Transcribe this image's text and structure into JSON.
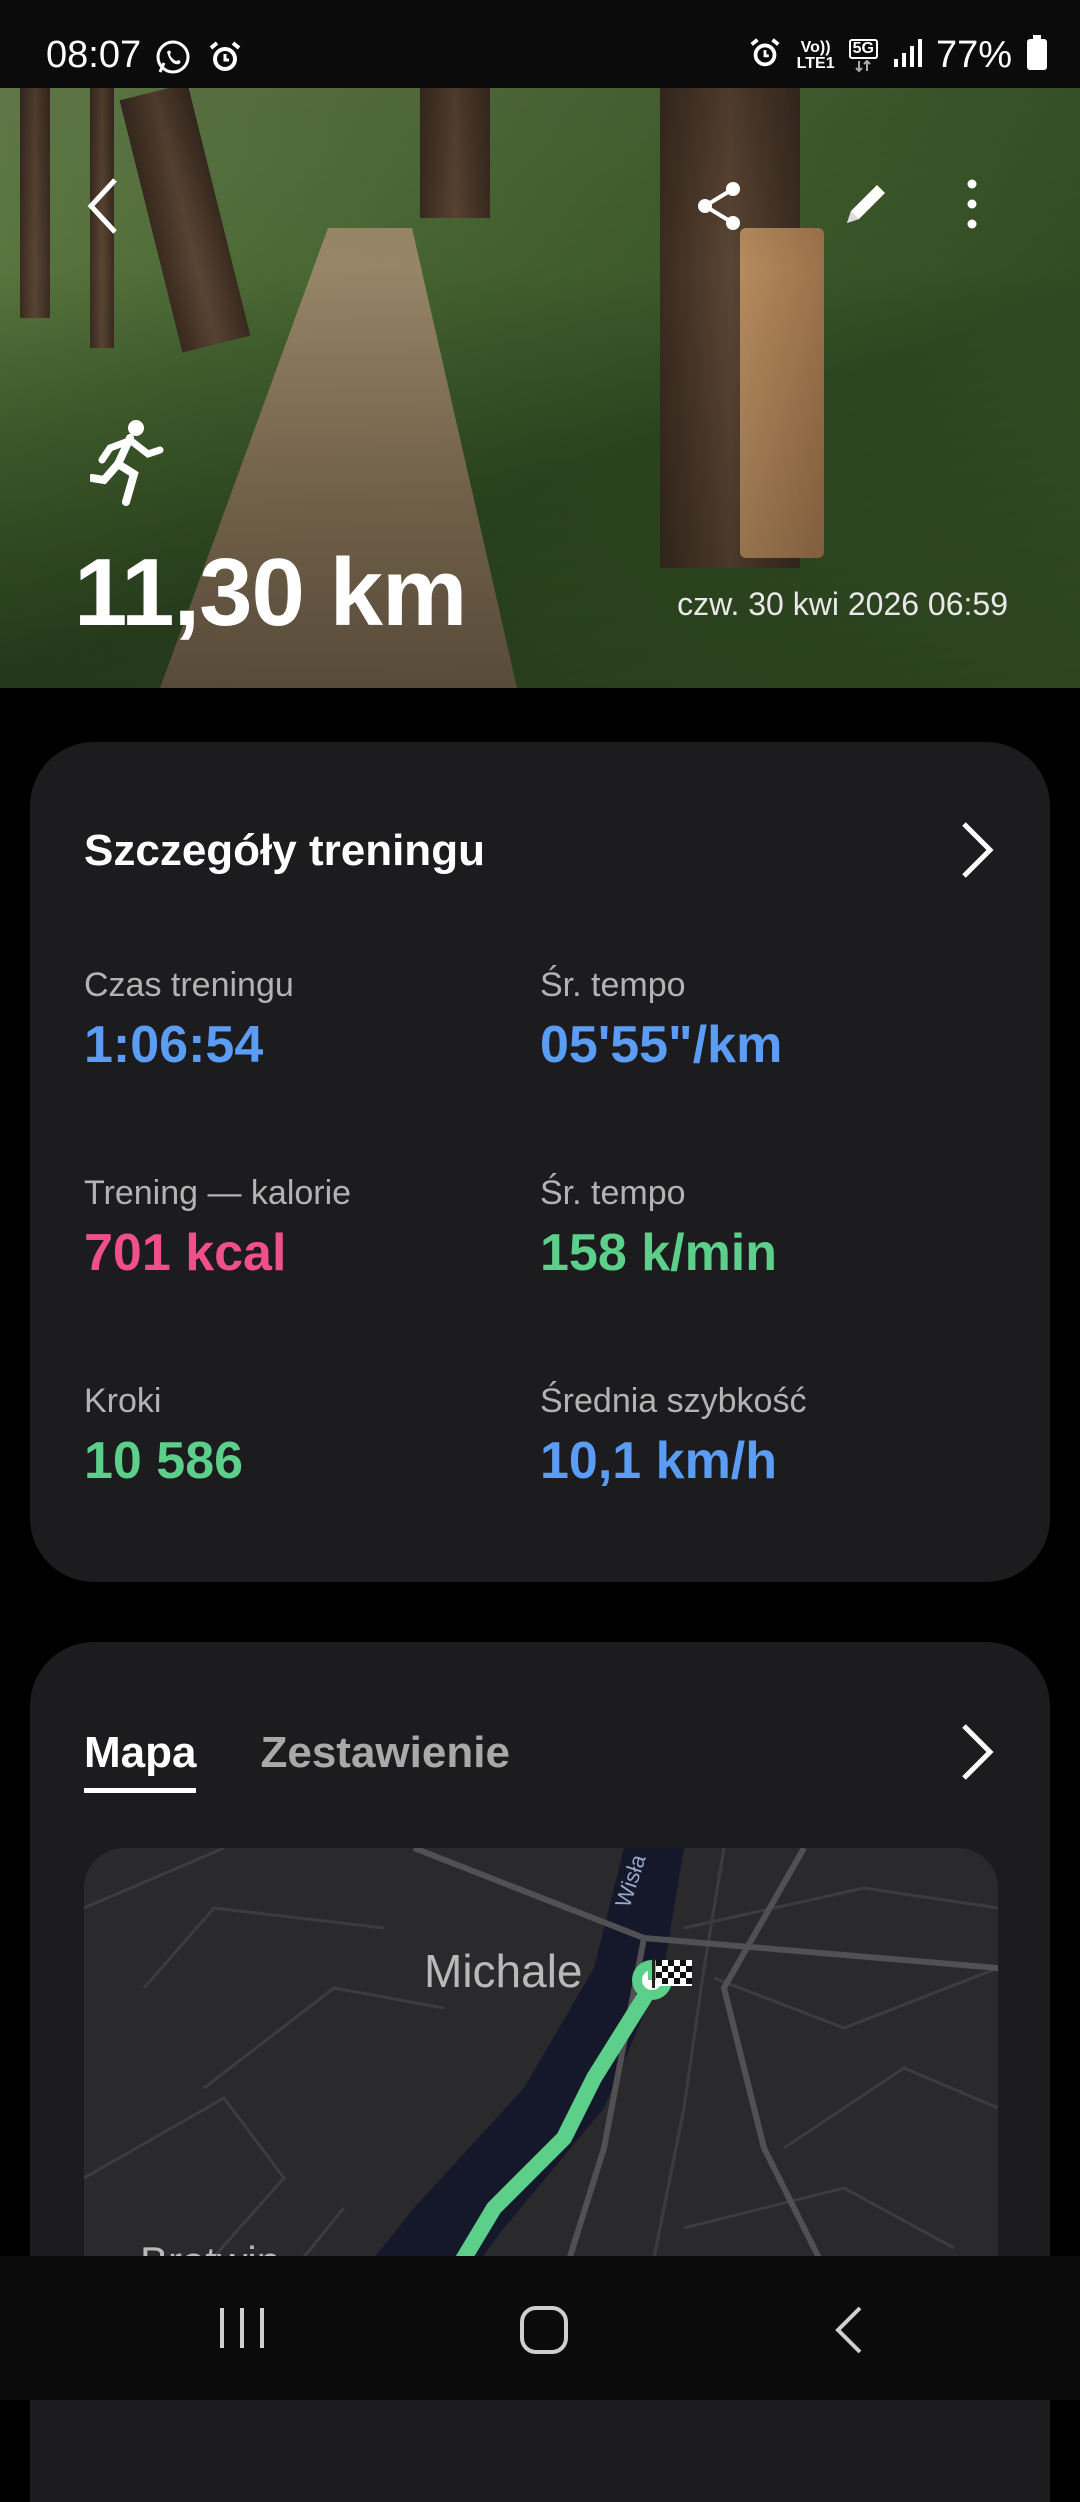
{
  "status_bar": {
    "time": "08:07",
    "battery": "77%",
    "network_top": "Vo))",
    "network_bottom": "LTE1",
    "generation": "5G"
  },
  "hero": {
    "distance": "11,30 km",
    "datetime": "czw. 30 kwi 2026 06:59",
    "icons": [
      "back-icon",
      "share-icon",
      "edit-icon",
      "more-icon",
      "running-icon"
    ]
  },
  "workout_details": {
    "title": "Szczegóły treningu",
    "stats": [
      {
        "label": "Czas treningu",
        "value": "1:06:54",
        "color": "#5b9cf5"
      },
      {
        "label": "Śr. tempo",
        "value": "05'55\"/km",
        "color": "#5b9cf5"
      },
      {
        "label": "Trening — kalorie",
        "value": "701 kcal",
        "color": "#f0508a"
      },
      {
        "label": "Śr. tempo",
        "value": "158 k/min",
        "color": "#5ccf8a"
      },
      {
        "label": "Kroki",
        "value": "10 586",
        "color": "#5ccf8a"
      },
      {
        "label": "Średnia szybkość",
        "value": "10,1 km/h",
        "color": "#5b9cf5"
      }
    ]
  },
  "map_card": {
    "tabs": [
      "Mapa",
      "Zestawienie"
    ],
    "active_tab": "Mapa",
    "labels": {
      "town1": "Michale",
      "town2": "Bratwin",
      "river": "Wisła"
    },
    "route_color": "#5ccf8a"
  },
  "colors": {
    "background": "#000000",
    "card": "#1c1c1e"
  }
}
